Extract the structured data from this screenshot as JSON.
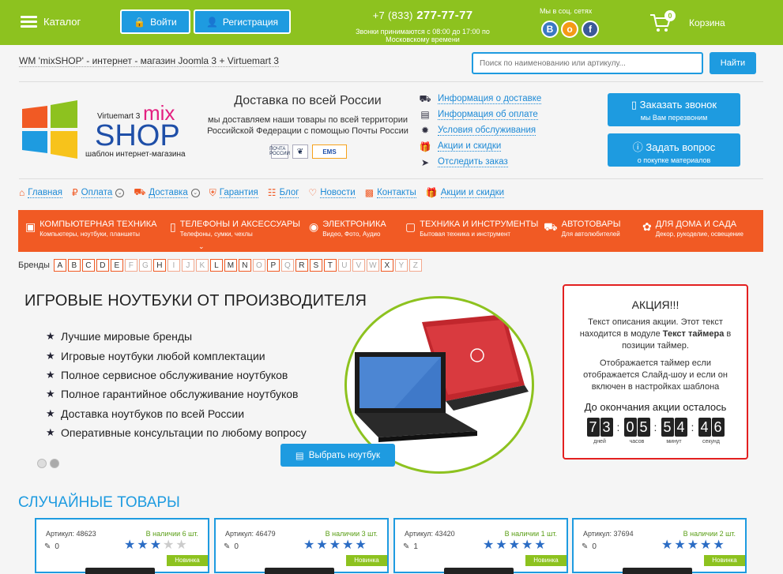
{
  "topbar": {
    "catalog": "Каталог",
    "login": "Войти",
    "register": "Регистрация",
    "phone_prefix": "+7 (833)",
    "phone_number": "277-77-77",
    "hours_line1": "Звонки принимаются с 08:00 до 17:00 по",
    "hours_line2": "Московскому времени",
    "social_label": "Мы в соц. сетях",
    "social": [
      "vk-icon",
      "odnoklassniki-icon",
      "facebook-icon"
    ],
    "cart_count": "0",
    "cart_label": "Корзина"
  },
  "site_title": "WM 'mixSHOP' - интернет - магазин Joomla 3 + Virtuemart 3",
  "search": {
    "placeholder": "Поиск по наименованию или артикулу...",
    "button": "Найти"
  },
  "logo": {
    "vm": "Virtuemart 3",
    "mix": "mix",
    "shop": "SHOP",
    "tagline": "шаблон интернет-магазина"
  },
  "delivery": {
    "title": "Доставка по всей России",
    "line1": "мы доставляем наши товары по всей территории",
    "line2": "Российской Федерации с помощью Почты России",
    "logo1": "ПОЧТА РОССИИ",
    "logo3": "EMS"
  },
  "info_links": [
    {
      "icon": "truck-icon",
      "label": "Информация о доставке"
    },
    {
      "icon": "card-icon",
      "label": "Информация об оплате"
    },
    {
      "icon": "gear-badge-icon",
      "label": "Условия обслуживания"
    },
    {
      "icon": "gift-icon",
      "label": "Акции и скидки"
    },
    {
      "icon": "paper-plane-icon",
      "label": "Отследить заказ"
    }
  ],
  "callback": {
    "title": "Заказать звонок",
    "sub": "мы Вам перезвоним"
  },
  "question": {
    "title": "Задать вопрос",
    "sub": "о покупке материалов"
  },
  "nav": [
    {
      "icon": "home-icon",
      "label": "Главная"
    },
    {
      "icon": "ruble-icon",
      "label": "Оплата"
    },
    {
      "icon": "truck-icon",
      "label": "Доставка"
    },
    {
      "icon": "shield-icon",
      "label": "Гарантия"
    },
    {
      "icon": "rss-icon",
      "label": "Блог"
    },
    {
      "icon": "megaphone-icon",
      "label": "Новости"
    },
    {
      "icon": "contact-card-icon",
      "label": "Контакты"
    },
    {
      "icon": "gift-icon",
      "label": "Акции и скидки"
    }
  ],
  "categories": [
    {
      "icon": "monitor-icon",
      "title": "КОМПЬЮТЕРНАЯ ТЕХНИКА",
      "sub": "Компьютеры, ноутбуки, планшеты"
    },
    {
      "icon": "phone-icon",
      "title": "ТЕЛЕФОНЫ И АКСЕССУАРЫ",
      "sub": "Телефоны, сумки, чехлы"
    },
    {
      "icon": "camera-icon",
      "title": "ЭЛЕКТРОНИКА",
      "sub": "Видео, Фото, Аудио"
    },
    {
      "icon": "tools-icon",
      "title": "ТЕХНИКА И ИНСТРУМЕНТЫ",
      "sub": "Бытовая техника и инструмент"
    },
    {
      "icon": "car-icon",
      "title": "АВТОТОВАРЫ",
      "sub": "Для автолюбителей"
    },
    {
      "icon": "home-plant-icon",
      "title": "ДЛЯ ДОМА И САДА",
      "sub": "Декор, рукоделие, освещение"
    }
  ],
  "brands_label": "Бренды",
  "brands": [
    "A",
    "B",
    "C",
    "D",
    "E",
    "F",
    "G",
    "H",
    "I",
    "J",
    "K",
    "L",
    "M",
    "N",
    "O",
    "P",
    "Q",
    "R",
    "S",
    "T",
    "U",
    "V",
    "W",
    "X",
    "Y",
    "Z"
  ],
  "promo": {
    "title": "ИГРОВЫЕ НОУТБУКИ ОТ ПРОИЗВОДИТЕЛЯ",
    "features": [
      "Лучшие мировые бренды",
      "Игровые ноутбуки любой комплектации",
      "Полное сервисное обслуживание ноутбуков",
      "Полное гарантийное обслуживание ноутбуков",
      "Доставка ноутбуков по всей России",
      "Оперативные консультации по любому вопросу"
    ],
    "button": "Выбрать ноутбук"
  },
  "action": {
    "title": "АКЦИЯ!!!",
    "p1_a": "Текст описания акции. Этот текст находится в модуле ",
    "p1_b": "Текст таймера",
    "p1_c": " в позиции таймер.",
    "p2": "Отображается таймер если отображается Слайд-шоу и если он включен в настройках шаблона",
    "until": "До окончания акции осталось",
    "timer": [
      {
        "digits": [
          "7",
          "3"
        ],
        "unit": "дней"
      },
      {
        "digits": [
          "0",
          "5"
        ],
        "unit": "часов"
      },
      {
        "digits": [
          "5",
          "4"
        ],
        "unit": "минут"
      },
      {
        "digits": [
          "4",
          "6"
        ],
        "unit": "секунд"
      }
    ]
  },
  "random_title": "СЛУЧАЙНЫЕ ТОВАРЫ",
  "products": [
    {
      "article": "Артикул: 48623",
      "stock": "В наличии 6 шт.",
      "reviews": "0",
      "rating": 3,
      "badge": "Новинка"
    },
    {
      "article": "Артикул: 46479",
      "stock": "В наличии 3 шт.",
      "reviews": "0",
      "rating": 5,
      "badge": "Новинка"
    },
    {
      "article": "Артикул: 43420",
      "stock": "В наличии 1 шт.",
      "reviews": "1",
      "rating": 5,
      "badge": "Новинка"
    },
    {
      "article": "Артикул: 37694",
      "stock": "В наличии 2 шт.",
      "reviews": "0",
      "rating": 5,
      "badge": "Новинка"
    }
  ],
  "colors": {
    "green": "#8dc21f",
    "blue": "#1e9be0",
    "orange": "#f15a24",
    "red": "#e32020"
  }
}
